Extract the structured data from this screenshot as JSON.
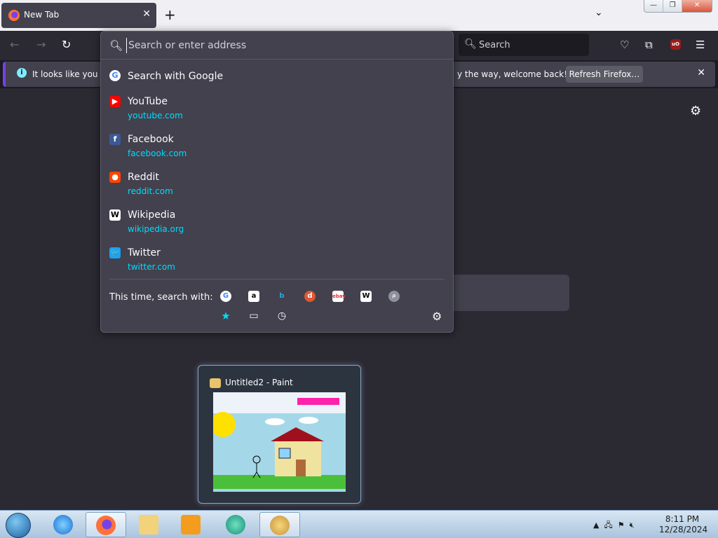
{
  "browser": {
    "tab": {
      "title": "New Tab"
    },
    "window_controls": {
      "minimize": "—",
      "maximize": "❐",
      "close": "✕"
    },
    "search_box": {
      "placeholder": "Search"
    },
    "address_bar": {
      "placeholder": "Search or enter address"
    }
  },
  "infobar": {
    "message_start": "It looks like you ha",
    "message_end": "y the way, welcome back!",
    "button": "Refresh Firefox…"
  },
  "dropdown": {
    "search_with_google": "Search with Google",
    "results": [
      {
        "label": "YouTube",
        "url": "youtube.com",
        "icon": "youtube-icon",
        "color": "#ff0000",
        "glyph": "▶"
      },
      {
        "label": "Facebook",
        "url": "facebook.com",
        "icon": "facebook-icon",
        "color": "#3b5998",
        "glyph": "f"
      },
      {
        "label": "Reddit",
        "url": "reddit.com",
        "icon": "reddit-icon",
        "color": "#ff4500",
        "glyph": "●"
      },
      {
        "label": "Wikipedia",
        "url": "wikipedia.org",
        "icon": "wikipedia-icon",
        "color": "#ffffff",
        "glyph": "W"
      },
      {
        "label": "Twitter",
        "url": "twitter.com",
        "icon": "twitter-icon",
        "color": "#1da1f2",
        "glyph": "🐦"
      }
    ],
    "search_with_label": "This time, search with:",
    "engines": [
      "google-icon",
      "amazon-icon",
      "bing-icon",
      "duckduckgo-icon",
      "ebay-icon",
      "wikipedia-icon",
      "search-icon"
    ],
    "modes": [
      "bookmarks-icon",
      "tabs-icon",
      "history-icon"
    ]
  },
  "taskbar_preview": {
    "title": "Untitled2 - Paint"
  },
  "taskbar": {
    "apps": [
      "internet-explorer-icon",
      "firefox-icon",
      "file-explorer-icon",
      "media-player-icon",
      "windows-live-icon",
      "paint-icon"
    ],
    "time": "8:11 PM",
    "date": "12/28/2024"
  }
}
